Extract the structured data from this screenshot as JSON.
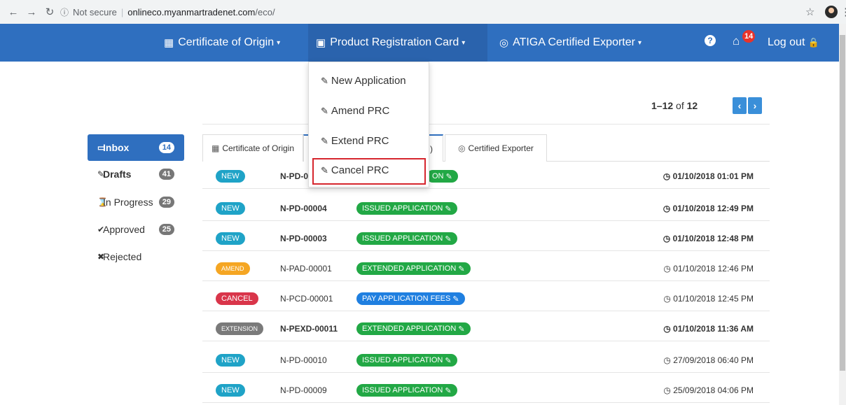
{
  "browser": {
    "url_secure_label": "Not secure",
    "url_domain": "onlineco.myanmartradenet.com",
    "url_path": "/eco/"
  },
  "navbar": {
    "items": [
      {
        "label": "Certificate of Origin"
      },
      {
        "label": "Product Registration Card"
      },
      {
        "label": "ATIGA Certified Exporter"
      }
    ],
    "help_label": "?",
    "notification_count": "14",
    "logout_label": "Log out"
  },
  "dropdown": {
    "items": [
      {
        "label": "New Application"
      },
      {
        "label": "Amend PRC"
      },
      {
        "label": "Extend PRC"
      },
      {
        "label": "Cancel PRC"
      }
    ]
  },
  "pagination": {
    "range": "1–12",
    "of_label": "of",
    "total": "12"
  },
  "sidebar": {
    "items": [
      {
        "label": "Inbox",
        "count": "14"
      },
      {
        "label": "Drafts",
        "count": "41"
      },
      {
        "label": "In Progress",
        "count": "29"
      },
      {
        "label": "Approved",
        "count": "25"
      },
      {
        "label": "Rejected",
        "count": ""
      }
    ]
  },
  "tabs": [
    {
      "label": "Certificate of Origin"
    },
    {
      "label": ")"
    },
    {
      "label": "Certified Exporter"
    }
  ],
  "rows": [
    {
      "type": "NEW",
      "ref": "N-PD-0",
      "status": "ON",
      "time": "01/10/2018 01:01 PM"
    },
    {
      "type": "NEW",
      "ref": "N-PD-00004",
      "status": "ISSUED APPLICATION",
      "time": "01/10/2018 12:49 PM"
    },
    {
      "type": "NEW",
      "ref": "N-PD-00003",
      "status": "ISSUED APPLICATION",
      "time": "01/10/2018 12:48 PM"
    },
    {
      "type": "AMEND",
      "ref": "N-PAD-00001",
      "status": "EXTENDED APPLICATION",
      "time": "01/10/2018 12:46 PM"
    },
    {
      "type": "CANCEL",
      "ref": "N-PCD-00001",
      "status": "PAY APPLICATION FEES",
      "time": "01/10/2018 12:45 PM"
    },
    {
      "type": "EXTENSION",
      "ref": "N-PEXD-00011",
      "status": "EXTENDED APPLICATION",
      "time": "01/10/2018 11:36 AM"
    },
    {
      "type": "NEW",
      "ref": "N-PD-00010",
      "status": "ISSUED APPLICATION",
      "time": "27/09/2018 06:40 PM"
    },
    {
      "type": "NEW",
      "ref": "N-PD-00009",
      "status": "ISSUED APPLICATION",
      "time": "25/09/2018 04:06 PM"
    }
  ],
  "colors": {
    "navbar": "#2f6fbf",
    "new_badge": "#1fa3c7",
    "amend_badge": "#f5a623",
    "cancel_badge": "#d9354a",
    "extension_badge": "#7a7a7a",
    "issued_status": "#22a845",
    "pay_status": "#1f7fe0",
    "highlight_border": "#d6262e"
  }
}
